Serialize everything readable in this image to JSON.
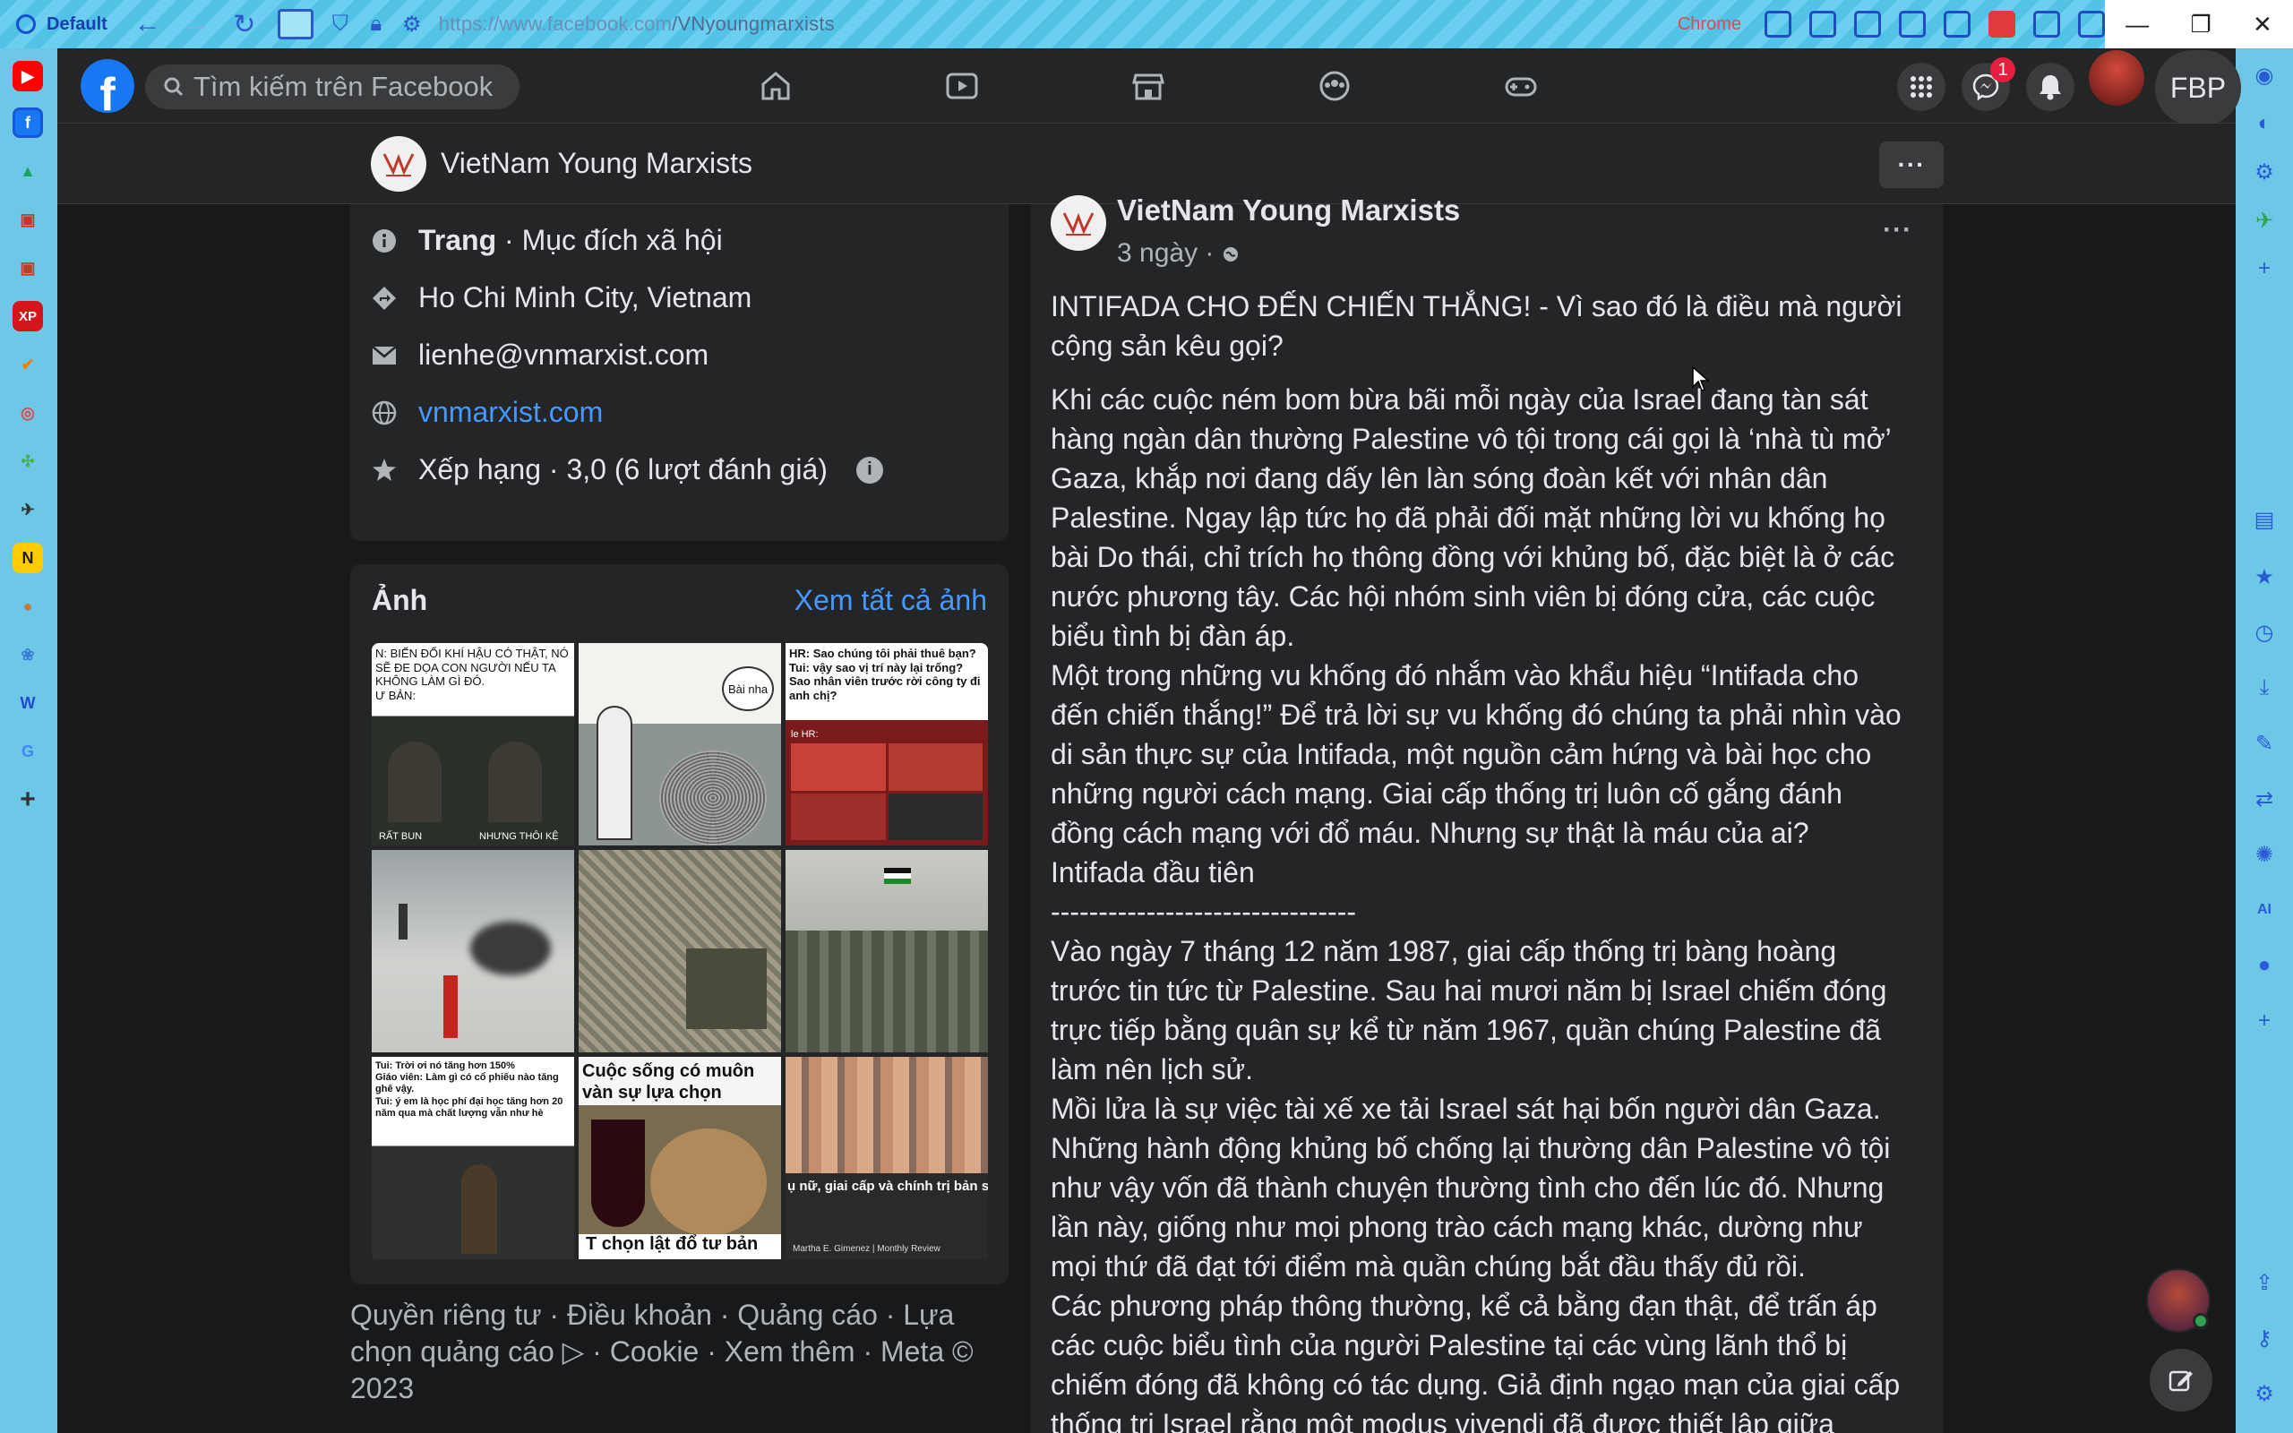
{
  "browser": {
    "profile_label": "Default",
    "url_prefix": "https://www.facebook.com",
    "url_path": "/VNyoungmarxists",
    "chrome_label": "Chrome"
  },
  "fb_nav": {
    "search_placeholder": "Tìm kiếm trên Facebook",
    "messenger_badge": "1",
    "profile_label": "FBP"
  },
  "page_header": {
    "name": "VietNam Young Marxists",
    "more_label": "···"
  },
  "intro": {
    "category_bold": "Trang",
    "category_rest": " · Mục đích xã hội",
    "location": "Ho Chi Minh City, Vietnam",
    "email": "lienhe@vnmarxist.com",
    "website": "vnmarxist.com",
    "rating": "Xếp hạng · 3,0 (6 lượt đánh giá)"
  },
  "photos": {
    "title": "Ảnh",
    "see_all": "Xem tất cả ảnh",
    "items": [
      {
        "caption": "N: BIẾN ĐỔI KHÍ HẬU CÓ THẬT, NÓ SẼ ĐE DỌA CON NGƯỜI NẾU TA KHÔNG LÀM GÌ ĐÓ.\nƯ BẢN:",
        "sub1": "RẤT BUN",
        "sub2": "NHƯNG THÔI KỆ"
      },
      {
        "caption": "Bài nha"
      },
      {
        "caption": "HR: Sao chúng tôi phải thuê bạn?\nTui: vậy sao vị trí này lại trống? Sao nhân viên trước rời công ty đi anh chị?",
        "sub1": "le HR:"
      },
      {
        "caption": ""
      },
      {
        "caption": ""
      },
      {
        "caption": ""
      },
      {
        "caption": "Tui: Trời ơi nó tăng hơn 150%\nGiáo viên: Làm gì có cổ phiếu nào tăng ghê vậy.\nTui: ý em là học phí đại học tăng hơn 20 năm qua mà chất lượng vẫn như hè"
      },
      {
        "caption": "Cuộc sống có muôn vàn sự lựa chọn",
        "sub1": "T chọn lật đổ tư bản"
      },
      {
        "caption": "ụ nữ, giai cấp và chính trị bản s",
        "sub1": "Martha E. Gimenez | Monthly Review"
      }
    ]
  },
  "footer": {
    "text": "Quyền riêng tư · Điều khoản · Quảng cáo · Lựa chọn quảng cáo ▷ · Cookie · Xem thêm · Meta © 2023"
  },
  "post": {
    "author": "VietNam Young Marxists",
    "time": "3 ngày · ",
    "more_label": "···",
    "title": "INTIFADA CHO ĐẾN CHIẾN THẮNG! - Vì sao đó là điều mà người cộng sản kêu gọi?",
    "p1": "Khi các cuộc ném bom bừa bãi mỗi ngày của Israel đang tàn sát hàng ngàn dân thường Palestine vô tội trong cái gọi là ‘nhà tù mở’ Gaza, khắp nơi đang dấy lên làn sóng đoàn kết với nhân dân Palestine. Ngay lập tức họ đã phải đối mặt những lời vu khống họ bài Do thái, chỉ trích họ thông đồng với khủng bố, đặc biệt là ở các nước phương tây. Các hội nhóm sinh viên bị đóng cửa, các cuộc biểu tình bị đàn áp.",
    "p2": "Một trong những vu khống đó nhắm vào khẩu hiệu “Intifada cho đến chiến thắng!” Để trả lời sự vu khống đó chúng ta phải nhìn vào di sản thực sự của Intifada, một nguồn cảm hứng và bài học cho những người cách mạng. Giai cấp thống trị luôn cố gắng đánh đồng cách mạng với đổ máu. Nhưng sự thật là máu của ai?",
    "p3": "Intifada đầu tiên",
    "p4": "--------------------------------",
    "p5": "Vào ngày 7 tháng 12 năm 1987, giai cấp thống trị bàng hoàng trước tin tức từ Palestine. Sau hai mươi năm bị Israel chiếm đóng trực tiếp bằng quân sự kể từ năm 1967, quần chúng Palestine đã làm nên lịch sử.",
    "p6": "Mồi lửa là sự việc tài xế xe tải Israel sát hại bốn người dân Gaza. Những hành động khủng bố chống lại thường dân Palestine vô tội như vậy vốn đã thành chuyện thường tình cho đến lúc đó. Nhưng lần này, giống như mọi phong trào cách mạng khác, dường như mọi thứ đã đạt tới điểm mà quần chúng bắt đầu thấy đủ rồi.",
    "p7": "Các phương pháp thông thường, kể cả bằng đạn thật, để trấn áp các cuộc biểu tình của người Palestine tại các vùng lãnh thổ bị chiếm đóng đã không có tác dụng. Giả định ngạo mạn của giai cấp thống trị Israel rằng một modus vivendi đã được thiết lập giữa"
  },
  "colors": {
    "fb_blue": "#1877f2",
    "link_blue": "#4599ff",
    "bg": "#18191a",
    "card": "#242526"
  }
}
